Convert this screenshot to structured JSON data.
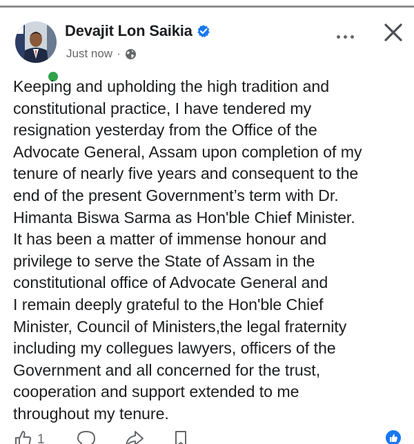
{
  "post": {
    "author": "Devajit Lon Saikia",
    "timestamp": "Just now",
    "separator": "·",
    "privacy_icon": "globe-icon",
    "verified_icon": "verified-badge-icon",
    "text": "Keeping and upholding the high tradition and\nconstitutional practice, I have tendered my\nresignation yesterday from the Office of the\nAdvocate General, Assam upon completion of my\ntenure of nearly five years and consequent to the\nend of the present Government’s term with Dr.\nHimanta Biswa Sarma as Hon'ble Chief Minister.\nIt has been a matter of immense honour and\nprivilege to serve the State of Assam in the\nconstitutional office of Advocate General and\nI remain deeply grateful to the Hon'ble Chief\nMinister, Council of Ministers,the legal fraternity\nincluding my collegues lawyers, officers of the\nGovernment and all concerned for the trust,\ncooperation and support extended to me\nthroughout my tenure."
  },
  "actions": {
    "like_count": "1",
    "icons": [
      "like-icon",
      "comment-icon",
      "share-icon",
      "save-icon",
      "reaction-badge-icon"
    ]
  },
  "colors": {
    "verified": "#1877f2",
    "online": "#31a24c",
    "meta_text": "#65676b",
    "body_text": "#1c1e21"
  }
}
